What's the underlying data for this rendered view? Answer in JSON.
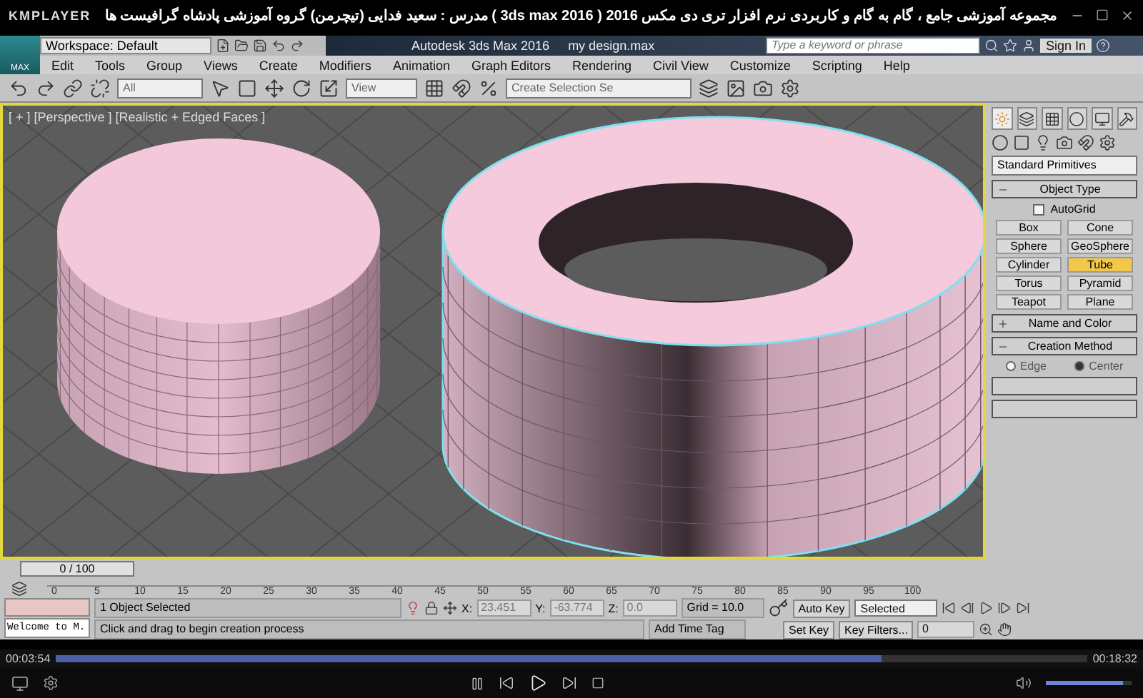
{
  "player": {
    "brand": "KMPLAYER",
    "title": "مجموعه آموزشی جامع ، گام به گام و کاربردی نرم افزار تری دی مکس 2016  ( 3ds max 2016 )  مدرس : سعید فدایی (تیچرمن) گروه آموزشی پادشاه گرافیست ها",
    "elapsed": "00:03:54",
    "total": "00:18:32",
    "progress": {
      "level": 0.8
    },
    "volume": {
      "level": 0.9
    }
  },
  "app": {
    "logo": "MAX",
    "workspace": "Workspace: Default",
    "title": "Autodesk 3ds Max 2016",
    "file": "my design.max",
    "search_placeholder": "Type a keyword or phrase",
    "sign_in": "Sign In"
  },
  "menu": [
    "Edit",
    "Tools",
    "Group",
    "Views",
    "Create",
    "Modifiers",
    "Animation",
    "Graph Editors",
    "Rendering",
    "Civil View",
    "Customize",
    "Scripting",
    "Help"
  ],
  "toolbar": {
    "selection_filter": "All",
    "reference_system": "View",
    "named_selection_placeholder": "Create Selection Se"
  },
  "viewport": {
    "label": "[ + ] [Perspective ] [Realistic + Edged Faces ]"
  },
  "command_panel": {
    "category": "Standard Primitives",
    "rollouts": [
      {
        "kind": "object_type",
        "title": "Object Type",
        "expanded": true
      },
      {
        "kind": "plain",
        "title": "Name and Color",
        "expanded": false
      },
      {
        "kind": "creation_method",
        "title": "Creation Method",
        "expanded": true
      }
    ],
    "autogrid": {
      "label": "AutoGrid",
      "checked": false
    },
    "object_buttons": [
      {
        "label": "Box",
        "selected": false
      },
      {
        "label": "Cone",
        "selected": false
      },
      {
        "label": "Sphere",
        "selected": false
      },
      {
        "label": "GeoSphere",
        "selected": false
      },
      {
        "label": "Cylinder",
        "selected": false
      },
      {
        "label": "Tube",
        "selected": true
      },
      {
        "label": "Torus",
        "selected": false
      },
      {
        "label": "Pyramid",
        "selected": false
      },
      {
        "label": "Teapot",
        "selected": false
      },
      {
        "label": "Plane",
        "selected": false
      }
    ],
    "creation_methods": [
      {
        "label": "Edge",
        "selected": false
      },
      {
        "label": "Center",
        "selected": true
      }
    ]
  },
  "timeline": {
    "frame_counter": "0 / 100",
    "ticks": [
      "0",
      "5",
      "10",
      "15",
      "20",
      "25",
      "30",
      "35",
      "40",
      "45",
      "50",
      "55",
      "60",
      "65",
      "70",
      "75",
      "80",
      "85",
      "90",
      "95",
      "100"
    ]
  },
  "status": {
    "listener": "Welcome to M.",
    "selection": "1 Object Selected",
    "prompt": "Click and drag to begin creation process",
    "coords": [
      {
        "label": "X:",
        "value": "23.451"
      },
      {
        "label": "Y:",
        "value": "-63.774"
      },
      {
        "label": "Z:",
        "value": "0.0"
      }
    ],
    "grid": "Grid = 10.0",
    "time_tag": "Add Time Tag",
    "auto_key": "Auto Key",
    "set_key": "Set Key",
    "key_mode": "Selected",
    "key_filters": "Key Filters...",
    "frame": "0"
  }
}
